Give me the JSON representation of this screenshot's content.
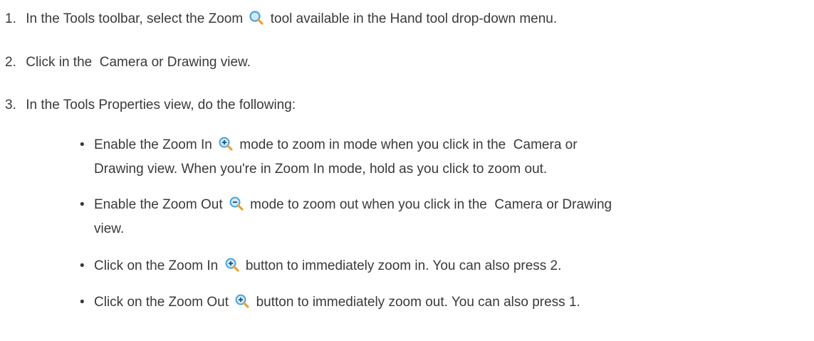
{
  "steps": [
    {
      "number": "1.",
      "text_before": "In the Tools toolbar, select the Zoom",
      "icon": "magnifier-icon",
      "text_after": "tool available in the Hand tool drop-down menu."
    },
    {
      "number": "2.",
      "text": "Click in the  Camera or Drawing view."
    },
    {
      "number": "3.",
      "text": "In the Tools Properties view, do the following:"
    }
  ],
  "bullets": [
    {
      "text_before": "Enable the Zoom In",
      "icon": "zoom-in-icon",
      "text_after": "mode to zoom in mode when you click in the  Camera or",
      "text_line2": "Drawing view. When you're in Zoom In mode, hold as you click to zoom out."
    },
    {
      "text_before": "Enable the Zoom Out",
      "icon": "zoom-out-icon",
      "text_after": "mode to zoom out when you click in the  Camera or Drawing",
      "text_line2": "view."
    },
    {
      "text_before": "Click on the Zoom In",
      "icon": "zoom-in-icon",
      "text_after": "button to immediately zoom in. You can also press 2."
    },
    {
      "text_before": "Click on the Zoom Out",
      "icon": "zoom-in-icon",
      "text_after": "button to immediately zoom out. You can also press 1."
    }
  ],
  "colors": {
    "text": "#3a3a3a",
    "lens": "#4aa3d8",
    "handle": "#e8a13a"
  }
}
